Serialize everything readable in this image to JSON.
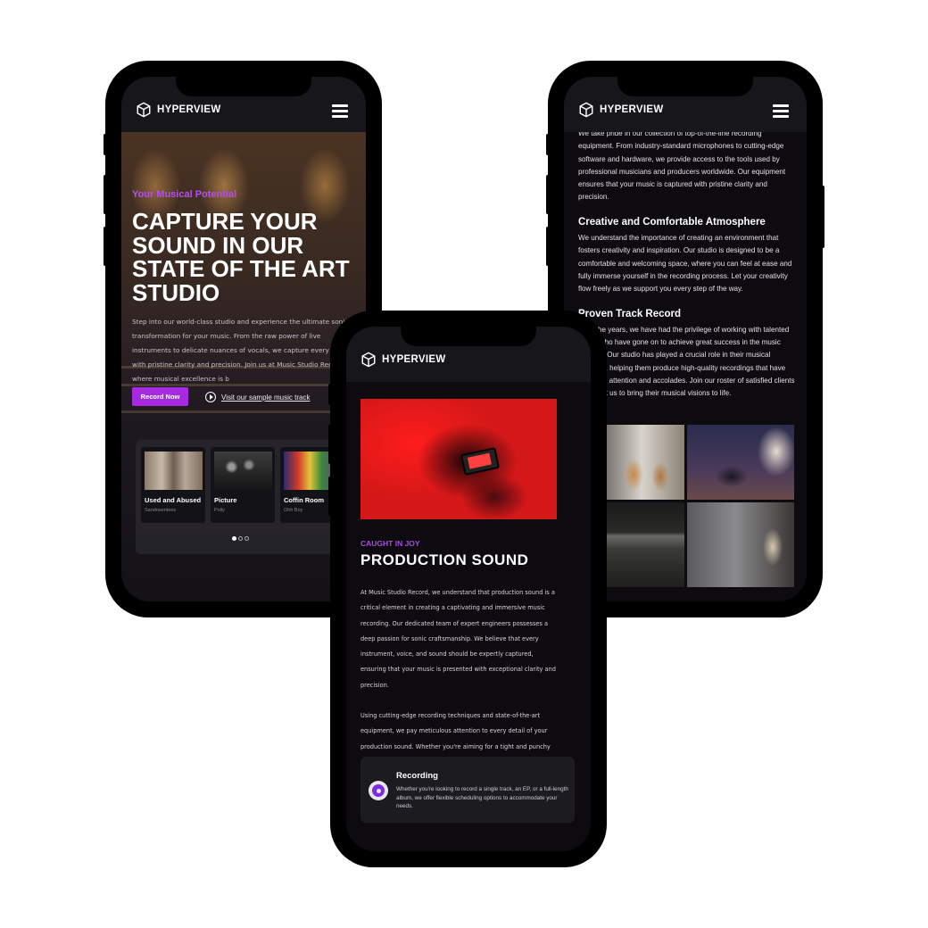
{
  "brand": {
    "name": "HYPERVIEW"
  },
  "phone1": {
    "kicker": "Your Musical Potential",
    "title": "CAPTURE YOUR SOUND IN OUR STATE OF THE ART STUDIO",
    "description": "Step into our world-class studio and experience the ultimate sonic transformation for your music. From the raw power of live instruments to delicate nuances of vocals, we capture every note with pristine clarity and precision. Join us at Music Studio Record, where musical excellence is b",
    "record_button": "Record Now",
    "sample_link": "Visit our sample music track",
    "cards": [
      {
        "title": "Used and Abused",
        "subtitle": "Sandosentees"
      },
      {
        "title": "Picture",
        "subtitle": "Polly"
      },
      {
        "title": "Coffin Room",
        "subtitle": "Ohh Boy"
      }
    ]
  },
  "phone2": {
    "kicker": "CAUGHT IN JOY",
    "title": "PRODUCTION SOUND",
    "paragraph1": "At Music Studio Record, we understand that production sound is a critical element in creating a captivating and immersive music recording. Our dedicated team of expert engineers possesses a deep passion for sonic craftsmanship. We believe that every instrument, voice, and sound should be expertly captured, ensuring that your music is presented with exceptional clarity and precision.",
    "paragraph2": "Using cutting-edge recording techniques and state-of-the-art equipment, we pay meticulous attention to every detail of your production sound. Whether you're aiming for a tight and punchy mix or a spacious and atmospheric arrangement, our engineers possess the technical expertise and artistic intuition to realize your sonic vision.",
    "feature": {
      "title": "Recording",
      "description": "Whether you're looking to record a single track, an EP, or a full-length album, we offer flexible scheduling options to accommodate your needs."
    }
  },
  "phone3": {
    "intro": "We take pride in our collection of top-of-the-line recording equipment. From industry-standard microphones to cutting-edge software and hardware, we provide access to the tools used by professional musicians and producers worldwide. Our equipment ensures that your music is captured with pristine clarity and precision.",
    "section1_title": "Creative and Comfortable Atmosphere",
    "section1_body": "We understand the importance of creating an environment that fosters creativity and inspiration. Our studio is designed to be a comfortable and welcoming space, where you can feel at ease and fully immerse yourself in the recording process. Let your creativity flow freely as we support you every step of the way.",
    "section2_title": "Proven Track Record",
    "section2_body": "Over the years, we have had the privilege of working with talented artists who have gone on to achieve great success in the music industry. Our studio has played a crucial role in their musical journeys, helping them produce high-quality recordings that have garnered attention and accolades. Join our roster of satisfied clients who trust us to bring their musical visions to life."
  }
}
